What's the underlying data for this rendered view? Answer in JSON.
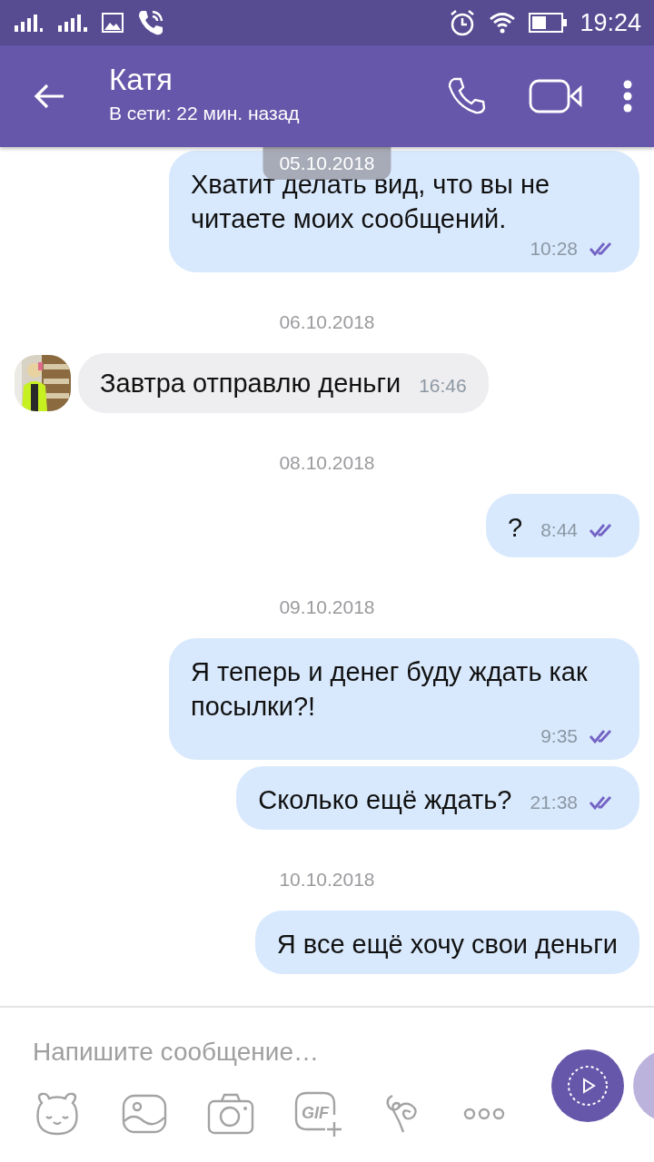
{
  "status_bar": {
    "time": "19:24"
  },
  "header": {
    "name": "Катя",
    "status": "В сети: 22 мин. назад"
  },
  "floating_date": "05.10.2018",
  "messages": [
    {
      "kind": "out",
      "text": "Хватит делать вид, что вы не читаете моих сообщений.",
      "time": "10:28",
      "read": true
    },
    {
      "kind": "date",
      "text": "06.10.2018"
    },
    {
      "kind": "in",
      "text": "Завтра отправлю деньги",
      "time": "16:46"
    },
    {
      "kind": "date",
      "text": "08.10.2018"
    },
    {
      "kind": "out",
      "text": "?",
      "time": "8:44",
      "read": true
    },
    {
      "kind": "date",
      "text": "09.10.2018"
    },
    {
      "kind": "out",
      "text": "Я теперь и денег буду ждать как посылки?!",
      "time": "9:35",
      "read": true
    },
    {
      "kind": "out",
      "text": "Сколько ещё ждать?",
      "time": "21:38",
      "read": true
    },
    {
      "kind": "date",
      "text": "10.10.2018"
    },
    {
      "kind": "out",
      "text": "Я все ещё хочу свои деньги"
    }
  ],
  "composer": {
    "placeholder": "Напишите сообщение…",
    "gif_label": "GIF"
  }
}
